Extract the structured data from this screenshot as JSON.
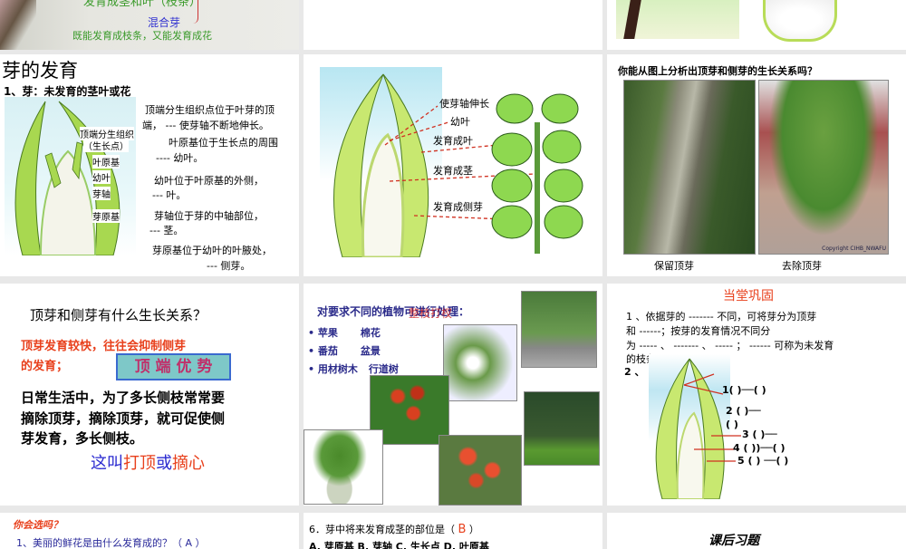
{
  "slides": [
    {
      "id": "mixed-bud",
      "label_mixed": "混合芽",
      "desc_mixed": "既能发育成枝条，又能发育成花",
      "cut_text": "发育成茎和叶（枝条）"
    },
    {
      "id": "blank"
    },
    {
      "id": "bud-photos"
    },
    {
      "id": "bud-development",
      "title": "芽的发育",
      "subtitle": "1、芽：未发育的茎叶或花",
      "labels": [
        "顶端分生组织",
        "（生长点）",
        "叶原基",
        "幼叶",
        "芽轴",
        "芽原基"
      ],
      "paragraphs": [
        "顶端分生组织点位于叶芽的顶",
        "端， --- 使芽轴不断地伸长。",
        "叶原基位于生长点的周围",
        "---- 幼叶。",
        "幼叶位于叶原基的外侧，",
        "--- 叶。",
        "芽轴位于芽的中轴部位，",
        "--- 茎。",
        "芽原基位于幼叶的叶腋处，",
        "--- 侧芽。"
      ]
    },
    {
      "id": "bud-to-shoot",
      "labels": [
        "使芽轴伸长",
        "幼叶",
        "发育成叶",
        "发育成茎",
        "发育成侧芽"
      ]
    },
    {
      "id": "tree-compare",
      "question": "你能从图上分析出顶芽和侧芽的生长关系吗？",
      "caption_left": "保留顶芽",
      "caption_right": "去除顶芽",
      "watermark": "Copyright CIHB_NWAFU"
    },
    {
      "id": "apical-dominance",
      "question": "顶芽和侧芽有什么生长关系？",
      "red_text_1": "顶芽发育较快，往往会抑制侧芽",
      "red_text_2": "的发育；",
      "box_label": "顶 端 优 势",
      "body_lines": [
        "日常生活中，为了多长侧枝常常要",
        "摘除顶芽，摘除顶芽，就可促使侧",
        "芽发育，多长侧枝。"
      ],
      "final_a": "这叫",
      "final_b": "打顶",
      "final_c": "或",
      "final_d": "摘心"
    },
    {
      "id": "plant-treatment",
      "heading": "对要求不同的植物可进行处理：",
      "overlay": "整枝打杈",
      "bullets": [
        [
          "苹果",
          "棉花"
        ],
        [
          "番茄",
          "盆景"
        ],
        [
          "用材树木",
          "行道树"
        ]
      ]
    },
    {
      "id": "review",
      "title": "当堂巩固",
      "lines": [
        "1 、依据芽的 ------- 不同，可将芽分为顶芽",
        "和 ------；按芽的发育情况不同分",
        "为 ----- 、 ------- 、 ----- ；      ------ 可称为未发育",
        "的枝条；",
        "2 、"
      ],
      "blanks": [
        "1(   )──(   )",
        "2 (   )──",
        "(   )",
        "3 (   )──",
        "4 (   ))──(   )",
        "5 (   ) ──(   )"
      ]
    },
    {
      "id": "quiz",
      "title": "你会选吗？",
      "q1": "1、美丽的鲜花是由什么发育成的？（ A ）"
    },
    {
      "id": "quiz6",
      "q6": "6．芽中将来发育成茎的部位是（",
      "answer": "B",
      "q6_end": "）",
      "options": "A. 芽原基   B. 芽轴   C. 生长点   D. 叶原基"
    },
    {
      "id": "homework",
      "title": "课后习题"
    }
  ],
  "colors": {
    "accent_red": "#e8401c",
    "blue": "#2a2ad0",
    "green_text": "#3a9a2a",
    "box_fill": "#7ec8c8"
  }
}
